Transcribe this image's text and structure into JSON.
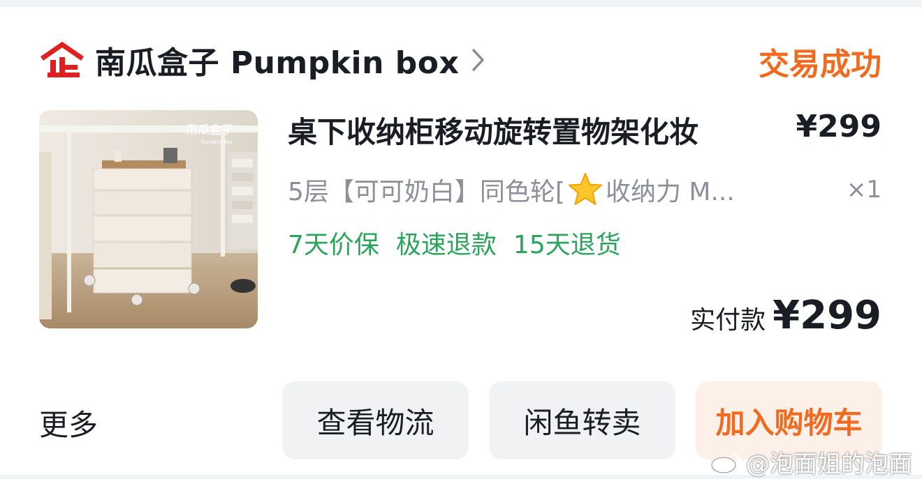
{
  "shop": {
    "name": "南瓜盒子 Pumpkin box",
    "status": "交易成功"
  },
  "product": {
    "image_brand_cn": "南瓜盒子",
    "image_brand_en": "Pumpkin Box",
    "title": "桌下收纳柜移动旋转置物架化妆",
    "price": "¥299",
    "sku_before_icon": "5层【可可奶白】同色轮[",
    "sku_after_icon": "收纳力 M...",
    "sku_icon": "star-icon",
    "quantity": "×1",
    "services": [
      "7天价保",
      "极速退款",
      "15天退货"
    ]
  },
  "payment": {
    "label": "实付款",
    "amount": "¥299"
  },
  "actions": {
    "more": "更多",
    "logistics": "查看物流",
    "resell": "闲鱼转卖",
    "add_to_cart": "加入购物车"
  },
  "watermark": "@泡面姐的泡面",
  "colors": {
    "accent_orange": "#f06a1f",
    "service_green": "#2aa45a",
    "logo_red": "#e02020",
    "muted_text": "#8c8f98",
    "button_bg": "#f1f2f4",
    "cart_button_bg": "#fdf0e8"
  }
}
